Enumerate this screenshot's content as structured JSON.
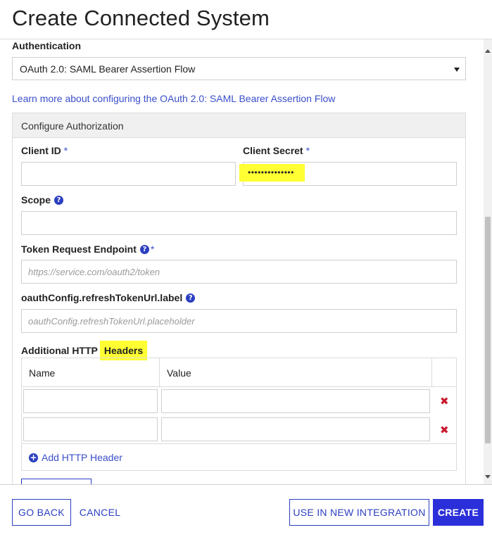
{
  "title": "Create Connected System",
  "authentication": {
    "label": "Authentication",
    "selected": "OAuth 2.0: SAML Bearer Assertion Flow"
  },
  "learn_link": "Learn more about configuring the OAuth 2.0: SAML Bearer Assertion Flow",
  "config": {
    "header": "Configure Authorization",
    "client_id": {
      "label": "Client ID",
      "required": "*",
      "value": ""
    },
    "client_secret": {
      "label": "Client Secret",
      "required": "*",
      "value": "••••••••••••••"
    },
    "scope": {
      "label": "Scope",
      "value": ""
    },
    "token_endpoint": {
      "label": "Token Request Endpoint",
      "required": "*",
      "placeholder": "https://service.com/oauth2/token"
    },
    "refresh_token": {
      "label": "oauthConfig.refreshTokenUrl.label",
      "placeholder": "oauthConfig.refreshTokenUrl.placeholder"
    },
    "headers": {
      "label_prefix": "Additional HTTP",
      "label_highlight": "Headers",
      "columns": [
        "Name",
        "Value"
      ],
      "rows": [
        {
          "name": "",
          "value": ""
        },
        {
          "name": "",
          "value": ""
        }
      ],
      "add_label": "Add HTTP Header"
    }
  },
  "footer": {
    "go_back": "GO BACK",
    "cancel": "CANCEL",
    "use_in_new": "USE IN NEW INTEGRATION",
    "create": "CREATE"
  },
  "colors": {
    "accent": "#2b3fc0",
    "primary_button": "#2b2fd9",
    "delete": "#c8192e",
    "highlight": "#ffff33"
  },
  "icons": {
    "help": "question-circle-icon",
    "delete": "close-x-icon",
    "add": "plus-circle-icon",
    "dropdown": "caret-down-icon"
  }
}
